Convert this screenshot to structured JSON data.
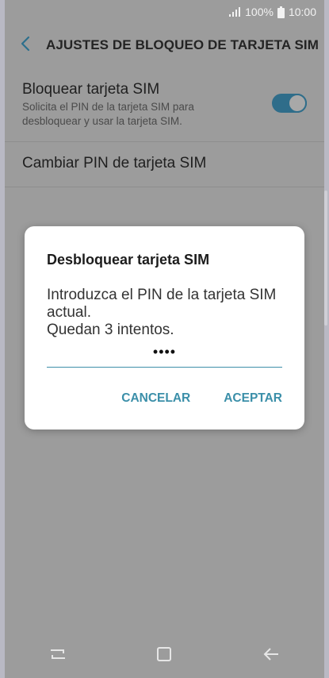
{
  "status_bar": {
    "battery_text": "100%",
    "time": "10:00"
  },
  "header": {
    "title": "AJUSTES DE BLOQUEO DE TARJETA SIM"
  },
  "settings": {
    "lock_sim": {
      "title": "Bloquear tarjeta SIM",
      "subtitle": "Solicita el PIN de la tarjeta SIM para desbloquear y usar la tarjeta SIM.",
      "enabled": true
    },
    "change_pin": {
      "title": "Cambiar PIN de tarjeta SIM"
    }
  },
  "dialog": {
    "title": "Desbloquear tarjeta SIM",
    "message_line1": "Introduzca el PIN de la tarjeta SIM actual.",
    "message_line2": "Quedan 3 intentos.",
    "pin_value": "••••",
    "cancel_label": "CANCELAR",
    "accept_label": "ACEPTAR"
  },
  "colors": {
    "accent": "#3b8fa9",
    "toggle_on": "#2f6d8a",
    "scrim_background": "#9c9c9c",
    "dialog_background": "#ffffff"
  },
  "icons": {
    "back": "chevron-left-icon",
    "signal": "signal-icon",
    "battery": "battery-icon",
    "nav_recents": "recent-apps-icon",
    "nav_home": "home-icon",
    "nav_back": "back-arrow-icon"
  }
}
